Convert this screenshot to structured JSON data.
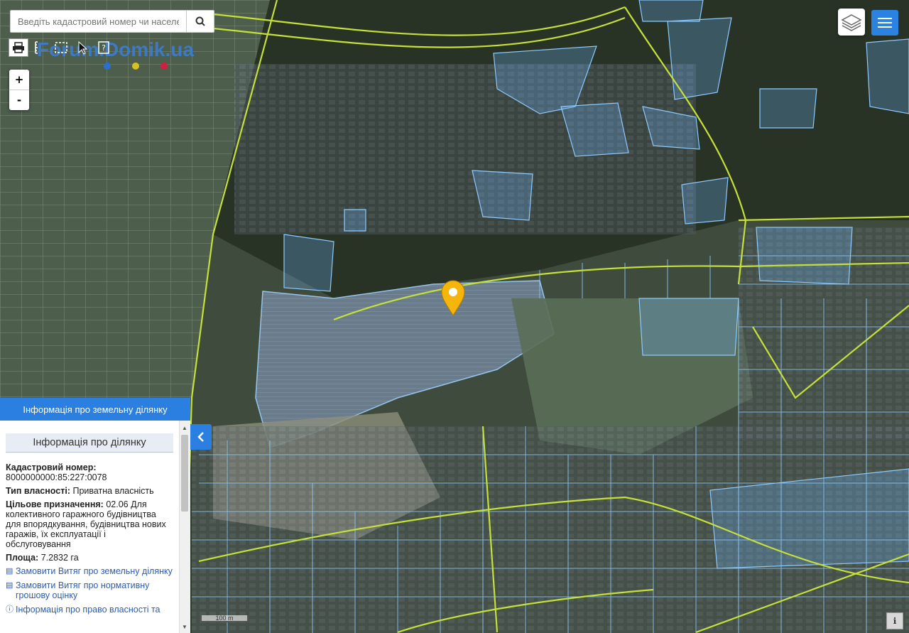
{
  "search": {
    "placeholder": "Введіть кадастровий номер чи населе"
  },
  "watermark": {
    "text": "Forum.Domik.ua",
    "dot_colors": [
      "#2b6fd0",
      "#d8c020",
      "#d02040"
    ]
  },
  "zoom": {
    "in": "+",
    "out": "-"
  },
  "toolbar": {
    "icons": [
      "print-icon",
      "ruler-icon",
      "select-area-icon",
      "pointer-icon",
      "help-icon"
    ]
  },
  "colors": {
    "parcel_stroke": "#7ec3ff",
    "road_line": "#c6e03a",
    "accent": "#2b7fe0",
    "marker": "#f5b50c"
  },
  "panel": {
    "header": "Інформація про земельну ділянку",
    "title": "Інформація про ділянку",
    "cadastral_label": "Кадастровий номер:",
    "cadastral_value": "8000000000:85:227:0078",
    "ownership_label": "Тип власності:",
    "ownership_value": "Приватна власність",
    "purpose_label": "Цільове призначення:",
    "purpose_value": "02.06 Для колективного гаражного будівництва для впорядкування, будівництва нових гаражів, їх експлуатації і обслуговування",
    "area_label": "Площа:",
    "area_value": "7.2832 га",
    "links": [
      "Замовити Витяг про земельну ділянку",
      "Замовити Витяг про нормативну грошову оцінку",
      "Інформація про право власності та"
    ]
  },
  "scale": {
    "label": "100 m"
  }
}
